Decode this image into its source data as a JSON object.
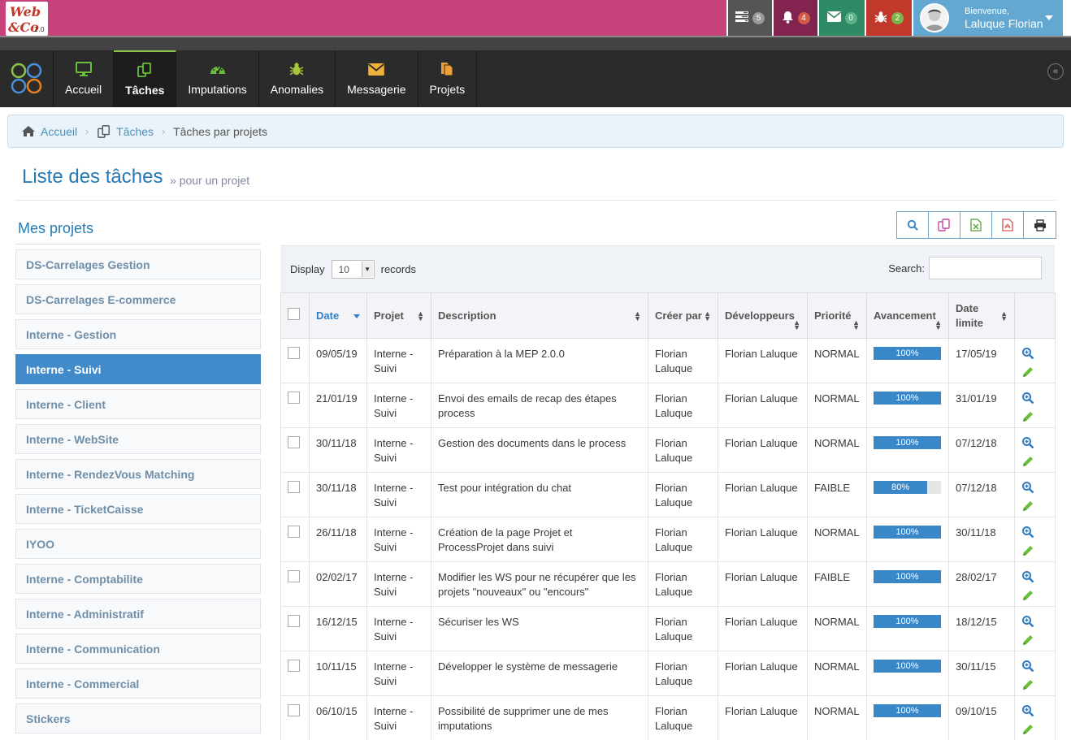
{
  "topbar": {
    "tasks_count": "5",
    "notifications_count": "4",
    "messages_count": "0",
    "bugs_count": "2",
    "welcome": "Bienvenue,",
    "user_name": "Laluque Florian"
  },
  "nav": {
    "items": [
      {
        "label": "Accueil",
        "icon": "monitor-icon"
      },
      {
        "label": "Tâches",
        "icon": "tasks-icon"
      },
      {
        "label": "Imputations",
        "icon": "dashboard-icon"
      },
      {
        "label": "Anomalies",
        "icon": "bug-icon"
      },
      {
        "label": "Messagerie",
        "icon": "envelope-icon"
      },
      {
        "label": "Projets",
        "icon": "files-icon"
      }
    ]
  },
  "breadcrumb": {
    "home": "Accueil",
    "tasks": "Tâches",
    "current": "Tâches par projets"
  },
  "page": {
    "title": "Liste des tâches",
    "subtitle": "pour un projet"
  },
  "sidebar": {
    "title": "Mes projets",
    "items": [
      "DS-Carrelages Gestion",
      "DS-Carrelages E-commerce",
      "Interne - Gestion",
      "Interne - Suivi",
      "Interne - Client",
      "Interne - WebSite",
      "Interne - RendezVous Matching",
      "Interne - TicketCaisse",
      "IYOO",
      "Interne - Comptabilite",
      "Interne - Administratif",
      "Interne - Communication",
      "Interne - Commercial",
      "Stickers"
    ]
  },
  "table_controls": {
    "display_label": "Display",
    "display_value": "10",
    "records_label": "records",
    "search_label": "Search:"
  },
  "table": {
    "headers": {
      "date": "Date",
      "projet": "Projet",
      "description": "Description",
      "creer_par": "Créer par",
      "developpeurs": "Développeurs",
      "priorite": "Priorité",
      "avancement": "Avancement",
      "date_limite": "Date limite"
    },
    "rows": [
      {
        "date": "09/05/19",
        "projet": "Interne - Suivi",
        "description": "Préparation à la MEP 2.0.0",
        "creer_par": "Florian Laluque",
        "developpeurs": "Florian Laluque",
        "priorite": "NORMAL",
        "avancement": "100%",
        "progress": 100,
        "date_limite": "17/05/19"
      },
      {
        "date": "21/01/19",
        "projet": "Interne - Suivi",
        "description": "Envoi des emails de recap des étapes process",
        "creer_par": "Florian Laluque",
        "developpeurs": "Florian Laluque",
        "priorite": "NORMAL",
        "avancement": "100%",
        "progress": 100,
        "date_limite": "31/01/19"
      },
      {
        "date": "30/11/18",
        "projet": "Interne - Suivi",
        "description": "Gestion des documents dans le process",
        "creer_par": "Florian Laluque",
        "developpeurs": "Florian Laluque",
        "priorite": "NORMAL",
        "avancement": "100%",
        "progress": 100,
        "date_limite": "07/12/18"
      },
      {
        "date": "30/11/18",
        "projet": "Interne - Suivi",
        "description": "Test pour intégration du chat",
        "creer_par": "Florian Laluque",
        "developpeurs": "Florian Laluque",
        "priorite": "FAIBLE",
        "avancement": "80%",
        "progress": 80,
        "date_limite": "07/12/18"
      },
      {
        "date": "26/11/18",
        "projet": "Interne - Suivi",
        "description": "Création de la page Projet et ProcessProjet dans suivi",
        "creer_par": "Florian Laluque",
        "developpeurs": "Florian Laluque",
        "priorite": "NORMAL",
        "avancement": "100%",
        "progress": 100,
        "date_limite": "30/11/18"
      },
      {
        "date": "02/02/17",
        "projet": "Interne - Suivi",
        "description": "Modifier les WS pour ne récupérer que les projets \"nouveaux\" ou \"encours\"",
        "creer_par": "Florian Laluque",
        "developpeurs": "Florian Laluque",
        "priorite": "FAIBLE",
        "avancement": "100%",
        "progress": 100,
        "date_limite": "28/02/17"
      },
      {
        "date": "16/12/15",
        "projet": "Interne - Suivi",
        "description": "Sécuriser les WS",
        "creer_par": "Florian Laluque",
        "developpeurs": "Florian Laluque",
        "priorite": "NORMAL",
        "avancement": "100%",
        "progress": 100,
        "date_limite": "18/12/15"
      },
      {
        "date": "10/11/15",
        "projet": "Interne - Suivi",
        "description": "Développer le système de messagerie",
        "creer_par": "Florian Laluque",
        "developpeurs": "Florian Laluque",
        "priorite": "NORMAL",
        "avancement": "100%",
        "progress": 100,
        "date_limite": "30/11/15"
      },
      {
        "date": "06/10/15",
        "projet": "Interne - Suivi",
        "description": "Possibilité de supprimer une de mes imputations",
        "creer_par": "Florian Laluque",
        "developpeurs": "Florian Laluque",
        "priorite": "NORMAL",
        "avancement": "100%",
        "progress": 100,
        "date_limite": "09/10/15"
      }
    ]
  },
  "colors": {
    "topbar_pink": "#c7417b",
    "accent_blue": "#428bca",
    "progress_blue": "#3a87c7",
    "link_blue": "#2679b5"
  }
}
